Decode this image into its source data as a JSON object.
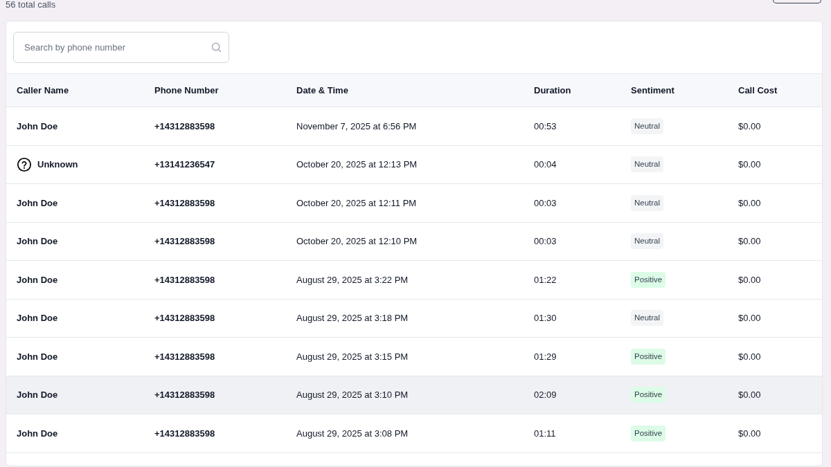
{
  "summary": "56 total calls",
  "search": {
    "placeholder": "Search by phone number"
  },
  "table": {
    "columns": [
      "Caller Name",
      "Phone Number",
      "Date & Time",
      "Duration",
      "Sentiment",
      "Call Cost"
    ],
    "rows": [
      {
        "caller": "John Doe",
        "kind": "known",
        "phone": "+14312883598",
        "datetime": "November 7, 2025 at 6:56 PM",
        "duration": "00:53",
        "sentiment": "Neutral",
        "color": "#f3f4f6",
        "cost": "$0.00",
        "highlighted": false
      },
      {
        "caller": "Unknown",
        "kind": "unknown",
        "phone": "+13141236547",
        "datetime": "October 20, 2025 at 12:13 PM",
        "duration": "00:04",
        "sentiment": "Neutral",
        "color": "#f3f4f6",
        "cost": "$0.00",
        "highlighted": false
      },
      {
        "caller": "John Doe",
        "kind": "known",
        "phone": "+14312883598",
        "datetime": "October 20, 2025 at 12:11 PM",
        "duration": "00:03",
        "sentiment": "Neutral",
        "color": "#f3f4f6",
        "cost": "$0.00",
        "highlighted": false
      },
      {
        "caller": "John Doe",
        "kind": "known",
        "phone": "+14312883598",
        "datetime": "October 20, 2025 at 12:10 PM",
        "duration": "00:03",
        "sentiment": "Neutral",
        "color": "#f3f4f6",
        "cost": "$0.00",
        "highlighted": false
      },
      {
        "caller": "John Doe",
        "kind": "known",
        "phone": "+14312883598",
        "datetime": "August 29, 2025 at 3:22 PM",
        "duration": "01:22",
        "sentiment": "Positive",
        "color": "#dcfce7",
        "cost": "$0.00",
        "highlighted": false
      },
      {
        "caller": "John Doe",
        "kind": "known",
        "phone": "+14312883598",
        "datetime": "August 29, 2025 at 3:18 PM",
        "duration": "01:30",
        "sentiment": "Neutral",
        "color": "#f3f4f6",
        "cost": "$0.00",
        "highlighted": false
      },
      {
        "caller": "John Doe",
        "kind": "known",
        "phone": "+14312883598",
        "datetime": "August 29, 2025 at 3:15 PM",
        "duration": "01:29",
        "sentiment": "Positive",
        "color": "#dcfce7",
        "cost": "$0.00",
        "highlighted": false
      },
      {
        "caller": "John Doe",
        "kind": "known",
        "phone": "+14312883598",
        "datetime": "August 29, 2025 at 3:10 PM",
        "duration": "02:09",
        "sentiment": "Positive",
        "color": "#dcfce7",
        "cost": "$0.00",
        "highlighted": true
      },
      {
        "caller": "John Doe",
        "kind": "known",
        "phone": "+14312883598",
        "datetime": "August 29, 2025 at 3:08 PM",
        "duration": "01:11",
        "sentiment": "Positive",
        "color": "#dcfce7",
        "cost": "$0.00",
        "highlighted": false
      }
    ]
  }
}
